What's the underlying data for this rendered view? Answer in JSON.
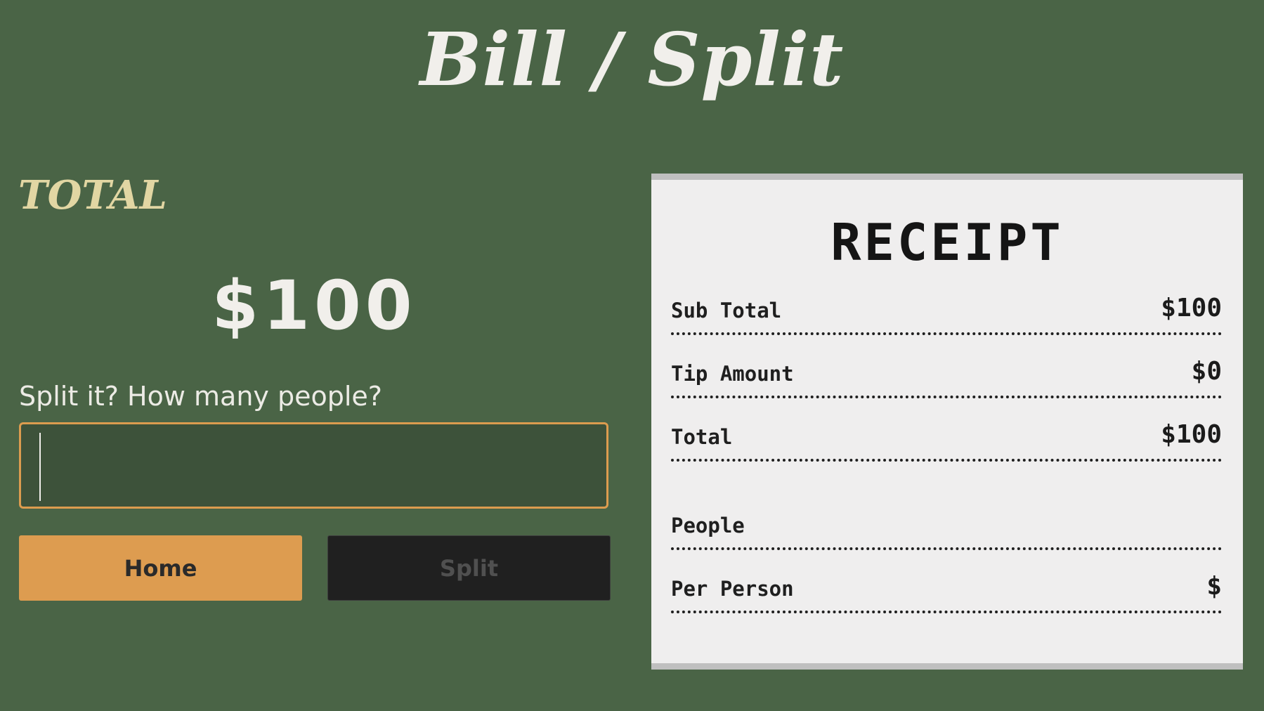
{
  "header": {
    "title": "Bill / Split"
  },
  "left": {
    "total_label": "TOTAL",
    "total_amount": "$100",
    "split_prompt": "Split it? How many people?",
    "people_input_value": "",
    "home_button": "Home",
    "split_button": "Split"
  },
  "receipt": {
    "title": "RECEIPT",
    "rows": [
      {
        "label": "Sub Total",
        "value": "$100"
      },
      {
        "label": "Tip Amount",
        "value": "$0"
      },
      {
        "label": "Total",
        "value": "$100"
      },
      {
        "label": "People",
        "value": ""
      },
      {
        "label": "Per Person",
        "value": "$"
      }
    ]
  },
  "colors": {
    "background": "#4a6446",
    "accent_orange": "#dd9c50",
    "total_label": "#e2d6a3",
    "receipt_paper": "#efeeee",
    "split_button_bg": "#202020"
  }
}
